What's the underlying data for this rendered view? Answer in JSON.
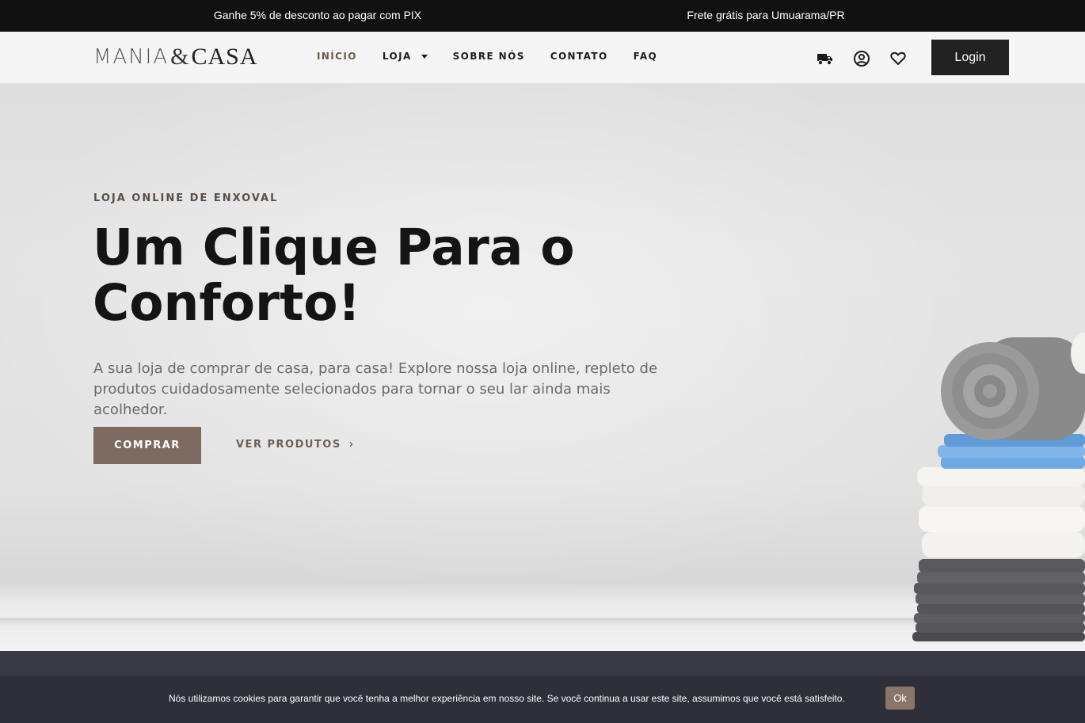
{
  "topbar": {
    "promo_left": "Ganhe 5% de desconto ao pagar com PIX",
    "promo_right": "Frete grátis para Umuarama/PR"
  },
  "header": {
    "logo": {
      "part1": "MANIA",
      "amp": "&",
      "part2": "CASA"
    },
    "nav": [
      {
        "label": "INÍCIO",
        "active": true
      },
      {
        "label": "LOJA",
        "has_dropdown": true
      },
      {
        "label": "SOBRE NÓS"
      },
      {
        "label": "CONTATO"
      },
      {
        "label": "FAQ"
      }
    ],
    "icons": [
      "delivery-truck-icon",
      "user-account-icon",
      "heart-wishlist-icon"
    ],
    "login_label": "Login"
  },
  "hero": {
    "eyebrow": "LOJA ONLINE DE ENXOVAL",
    "headline_line1": "Um Clique Para o",
    "headline_line2": "Conforto!",
    "subtext": "A sua loja de comprar de casa, para casa! Explore nossa loja online, repleto de produtos cuidadosamente selecionados para tornar o seu lar ainda mais acolhedor.",
    "cta_primary": "COMPRAR",
    "cta_secondary": "VER PRODUTOS"
  },
  "cookie_banner": {
    "text": "Nós utilizamos cookies para garantir que você tenha a melhor experiência em nosso site. Se você continua a usar este site, assumimos que você está satisfeito.",
    "ok_label": "Ok"
  },
  "colors": {
    "topbar_bg": "#111111",
    "accent_brown": "#7d6b61",
    "login_bg": "#222222",
    "cookie_bg": "#2e2f39",
    "cookie_ok_bg": "#8a7569"
  }
}
